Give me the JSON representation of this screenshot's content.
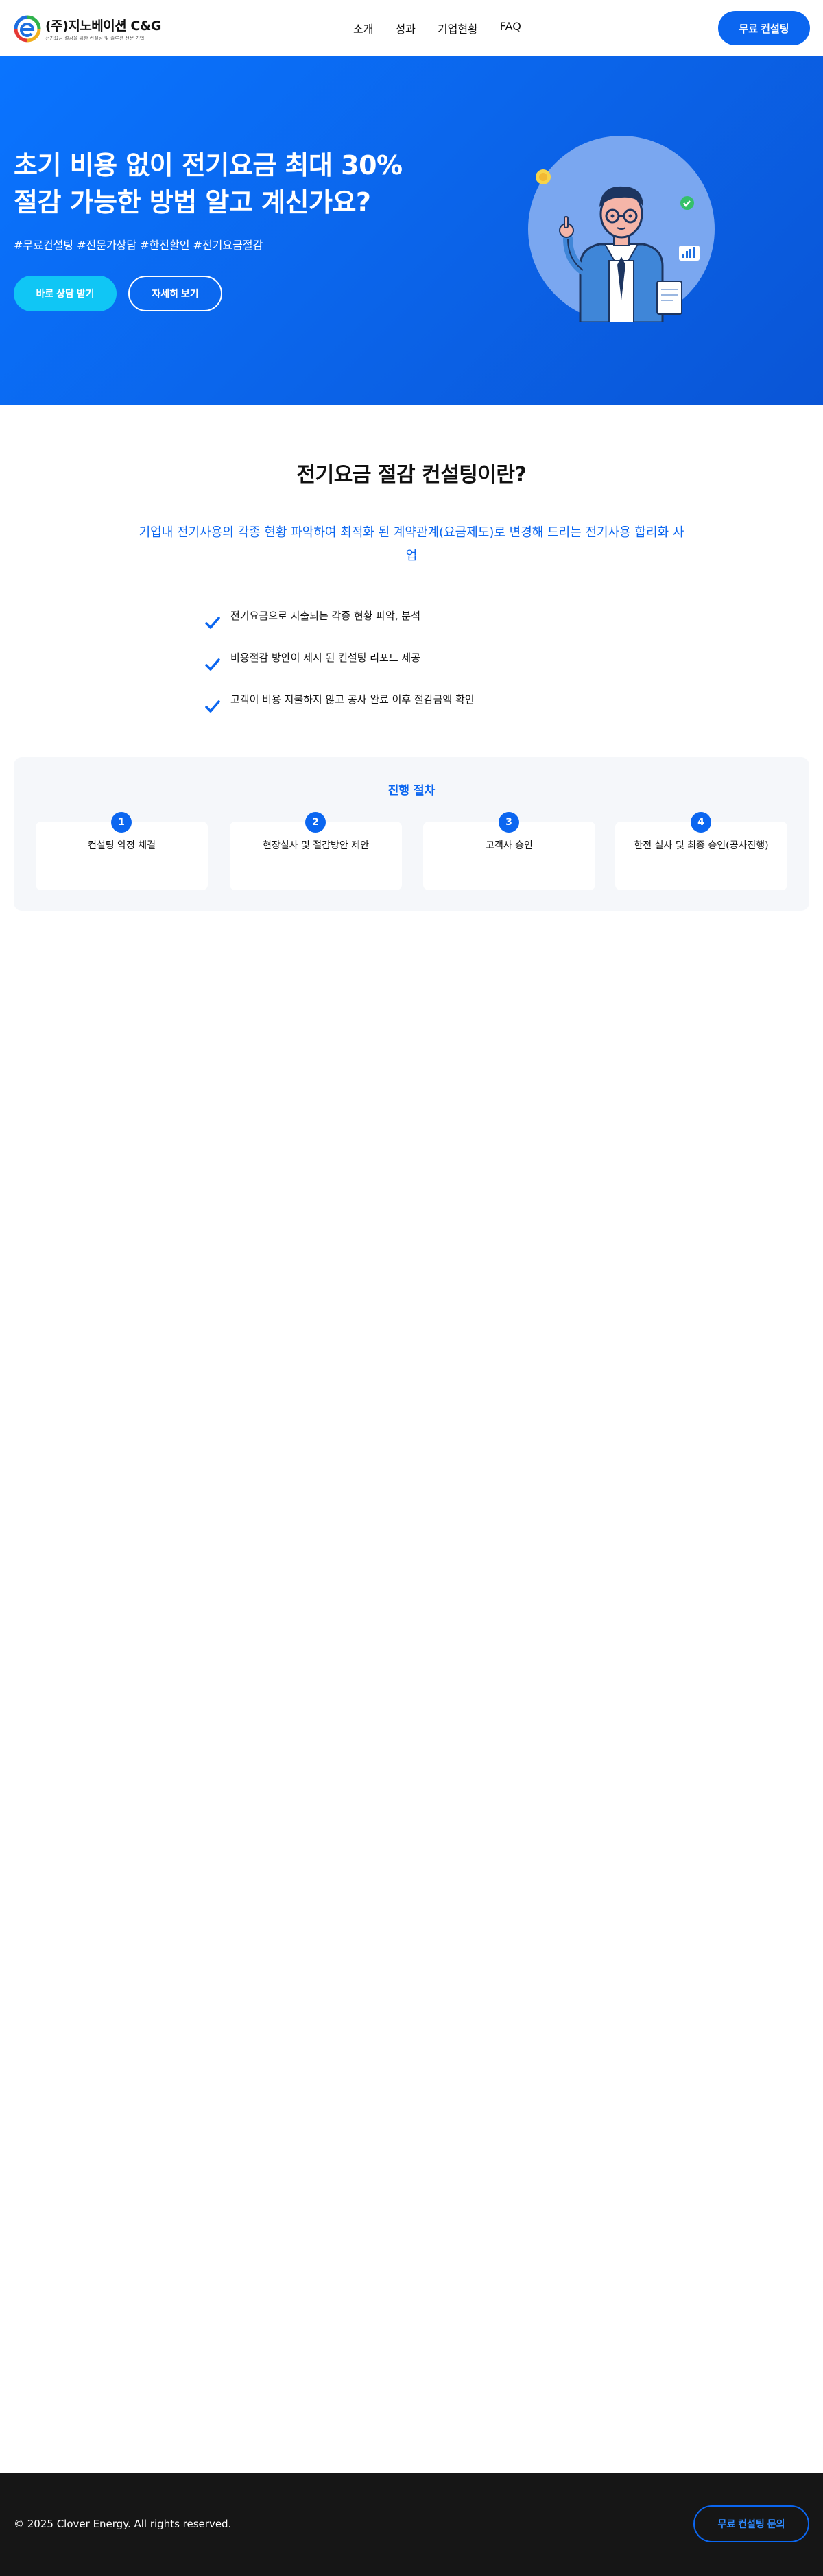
{
  "brand": {
    "name": "(주)지노베이션 C&G",
    "tagline": "전기요금 절감을 위한 컨설팅 및 솔루션 전문 기업",
    "colors": {
      "primary": "#0b66f0",
      "accent": "#10c6f5",
      "footer_bg": "#161616"
    }
  },
  "nav": {
    "items": [
      "소개",
      "성과",
      "기업현황",
      "FAQ"
    ],
    "cta_label": "무료 컨설팅"
  },
  "hero": {
    "title_line1": "초기 비용 없이 전기요금 최대 30%",
    "title_line2": "절감 가능한 방법 알고 계신가요?",
    "tags": "#무료컨설팅 #전문가상담 #한전할인 #전기요금절감",
    "primary_button": "바로 상담 받기",
    "secondary_button": "자세히 보기",
    "illustration_icon": "consultant-illustration"
  },
  "about": {
    "title": "전기요금 절감 컨설팅이란?",
    "description": "기업내 전기사용의 각종 현황 파악하여 최적화 된 계약관계(요금제도)로 변경해 드리는 전기사용 합리화 사업",
    "checklist": [
      "전기요금으로 지출되는 각종 현황 파악, 분석",
      "비용절감 방안이 제시 된 컨설팅 리포트 제공",
      "고객이 비용 지불하지 않고 공사 완료 이후 절감금액 확인"
    ]
  },
  "process": {
    "title": "진행 절차",
    "steps": [
      {
        "num": "1",
        "label": "컨설팅 약정 체결"
      },
      {
        "num": "2",
        "label": "현장실사 및 절감방안 제안"
      },
      {
        "num": "3",
        "label": "고객사 승인"
      },
      {
        "num": "4",
        "label": "한전 실사 및 최종 승인(공사진행)"
      }
    ]
  },
  "footer": {
    "copyright": "© 2025 Clover Energy. All rights reserved.",
    "cta_label": "무료 컨설팅 문의"
  }
}
